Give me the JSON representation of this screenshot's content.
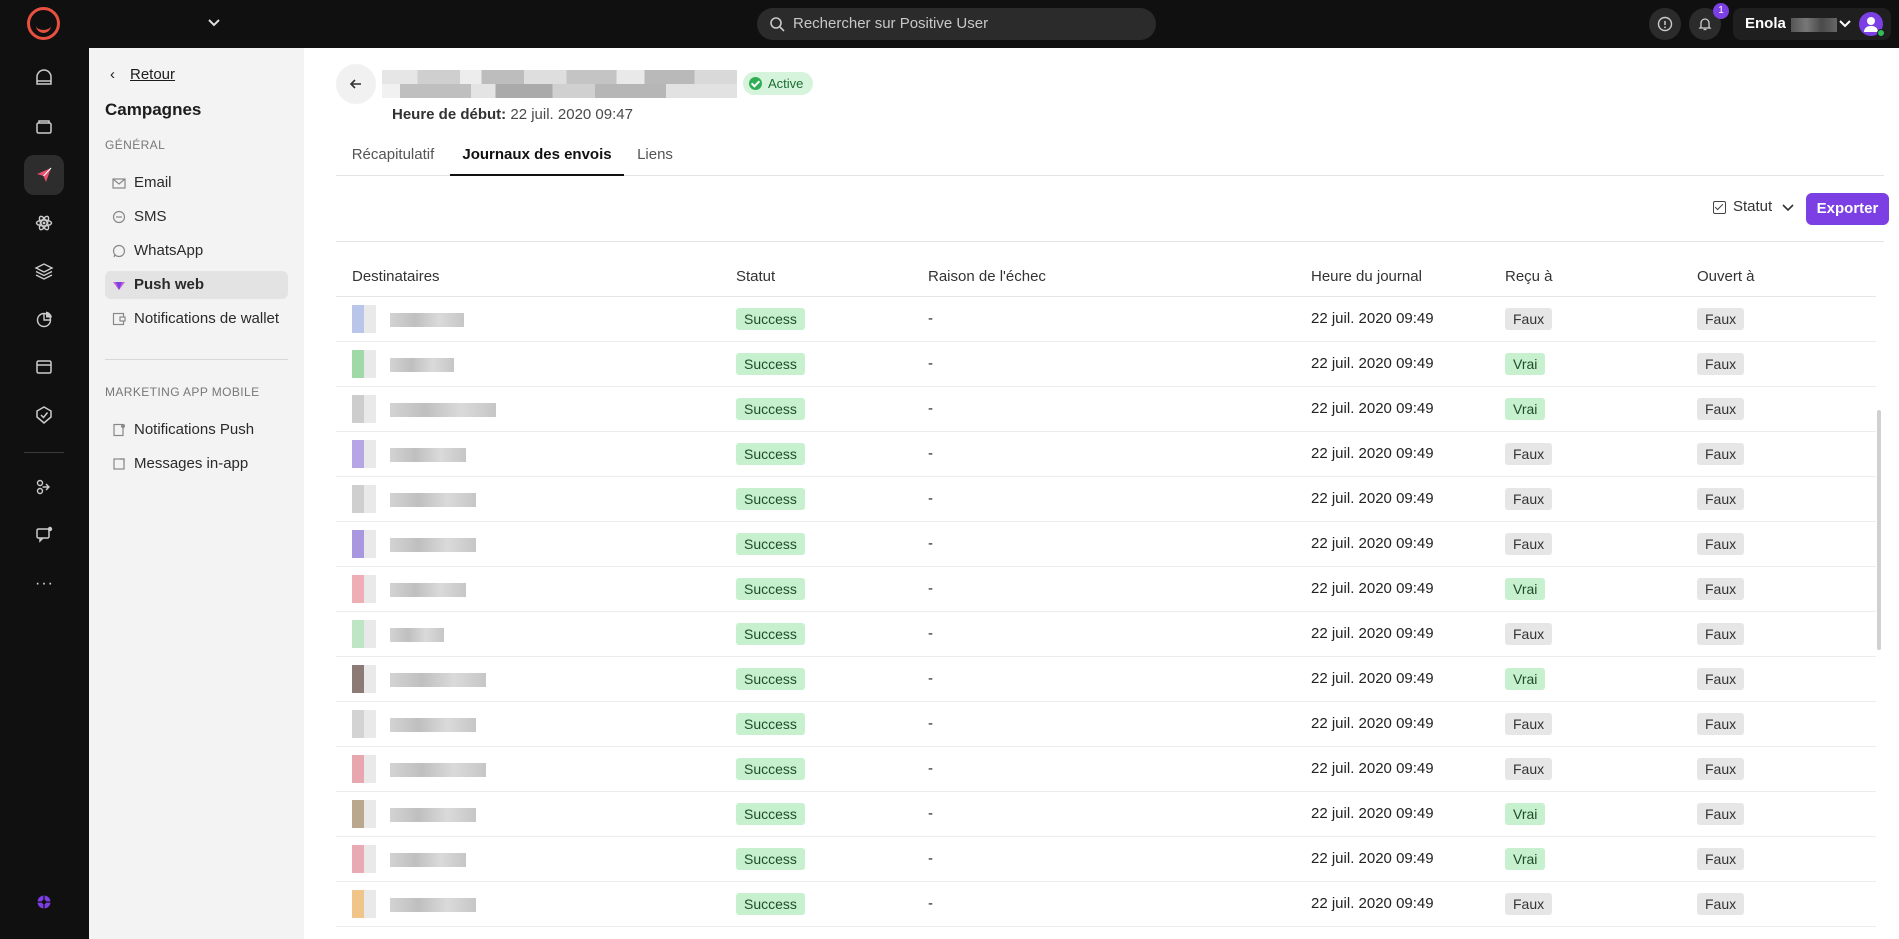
{
  "search": {
    "placeholder": "Rechercher sur Positive User"
  },
  "notifications": {
    "count": "1"
  },
  "user": {
    "name": "Enola"
  },
  "subnav": {
    "back_label": "Retour",
    "title": "Campagnes",
    "section_general": "GÉNÉRAL",
    "general_items": [
      {
        "label": "Email",
        "icon": "mail-icon"
      },
      {
        "label": "SMS",
        "icon": "sms-icon"
      },
      {
        "label": "WhatsApp",
        "icon": "whatsapp-icon"
      },
      {
        "label": "Push web",
        "icon": "push-web-icon",
        "active": true
      },
      {
        "label": "Notifications de wallet",
        "icon": "wallet-icon"
      }
    ],
    "section_mobile": "MARKETING APP MOBILE",
    "mobile_items": [
      {
        "label": "Notifications Push",
        "icon": "mobile-push-icon"
      },
      {
        "label": "Messages in-app",
        "icon": "in-app-icon"
      }
    ]
  },
  "header": {
    "status": "Active",
    "start_label": "Heure de début:",
    "start_value": "22 juil. 2020 09:47"
  },
  "tabs": [
    {
      "label": "Récapitulatif"
    },
    {
      "label": "Journaux des envois",
      "active": true
    },
    {
      "label": "Liens"
    }
  ],
  "toolbar": {
    "filter_label": "Statut",
    "export_label": "Exporter"
  },
  "table": {
    "columns": [
      "Destinataires",
      "Statut",
      "Raison de l'échec",
      "Heure du journal",
      "Reçu à",
      "Ouvert à"
    ],
    "rows": [
      {
        "status": "Success",
        "reason": "-",
        "time": "22 juil. 2020 09:49",
        "received": "Faux",
        "opened": "Faux",
        "avatar": "#b9c6ea"
      },
      {
        "status": "Success",
        "reason": "-",
        "time": "22 juil. 2020 09:49",
        "received": "Vrai",
        "opened": "Faux",
        "avatar": "#9fd9a7"
      },
      {
        "status": "Success",
        "reason": "-",
        "time": "22 juil. 2020 09:49",
        "received": "Vrai",
        "opened": "Faux",
        "avatar": "#cdcdcd"
      },
      {
        "status": "Success",
        "reason": "-",
        "time": "22 juil. 2020 09:49",
        "received": "Faux",
        "opened": "Faux",
        "avatar": "#b7a6e6"
      },
      {
        "status": "Success",
        "reason": "-",
        "time": "22 juil. 2020 09:49",
        "received": "Faux",
        "opened": "Faux",
        "avatar": "#cfcfcf"
      },
      {
        "status": "Success",
        "reason": "-",
        "time": "22 juil. 2020 09:49",
        "received": "Faux",
        "opened": "Faux",
        "avatar": "#a998e0"
      },
      {
        "status": "Success",
        "reason": "-",
        "time": "22 juil. 2020 09:49",
        "received": "Vrai",
        "opened": "Faux",
        "avatar": "#efadb5"
      },
      {
        "status": "Success",
        "reason": "-",
        "time": "22 juil. 2020 09:49",
        "received": "Faux",
        "opened": "Faux",
        "avatar": "#bfe6c4"
      },
      {
        "status": "Success",
        "reason": "-",
        "time": "22 juil. 2020 09:49",
        "received": "Vrai",
        "opened": "Faux",
        "avatar": "#8c7a76"
      },
      {
        "status": "Success",
        "reason": "-",
        "time": "22 juil. 2020 09:49",
        "received": "Faux",
        "opened": "Faux",
        "avatar": "#d3d3d3"
      },
      {
        "status": "Success",
        "reason": "-",
        "time": "22 juil. 2020 09:49",
        "received": "Faux",
        "opened": "Faux",
        "avatar": "#e8a6ae"
      },
      {
        "status": "Success",
        "reason": "-",
        "time": "22 juil. 2020 09:49",
        "received": "Vrai",
        "opened": "Faux",
        "avatar": "#b9a78e"
      },
      {
        "status": "Success",
        "reason": "-",
        "time": "22 juil. 2020 09:49",
        "received": "Vrai",
        "opened": "Faux",
        "avatar": "#eaaab3"
      },
      {
        "status": "Success",
        "reason": "-",
        "time": "22 juil. 2020 09:49",
        "received": "Faux",
        "opened": "Faux",
        "avatar": "#f0c58a"
      }
    ]
  },
  "colors": {
    "accent": "#7b3fe4",
    "brand": "#e8503f",
    "success_bg": "#c7f0cf",
    "neutral_bg": "#e6e6e6"
  }
}
